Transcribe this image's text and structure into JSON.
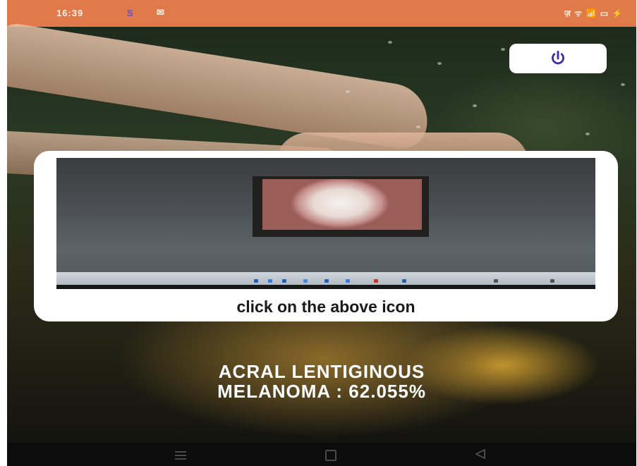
{
  "status_bar": {
    "time": "16:39",
    "app_indicator": "S",
    "mail_icon": "mail-icon",
    "right_icons": "ज़ ᯤ 📶 ▭ ⚡"
  },
  "power_button": {
    "icon": "power-icon",
    "color": "#3f2aa8"
  },
  "card": {
    "caption": "click on the above icon"
  },
  "result": {
    "line1": "ACRAL LENTIGINOUS",
    "line2": "MELANOMA : 62.055%"
  },
  "nav_bar": {
    "menu_icon": "menu-icon",
    "home_icon": "home-icon",
    "back_icon": "back-icon"
  },
  "colors": {
    "status_bar_bg": "#e07a4a",
    "card_bg": "#ffffff",
    "accent": "#3f2aa8"
  }
}
